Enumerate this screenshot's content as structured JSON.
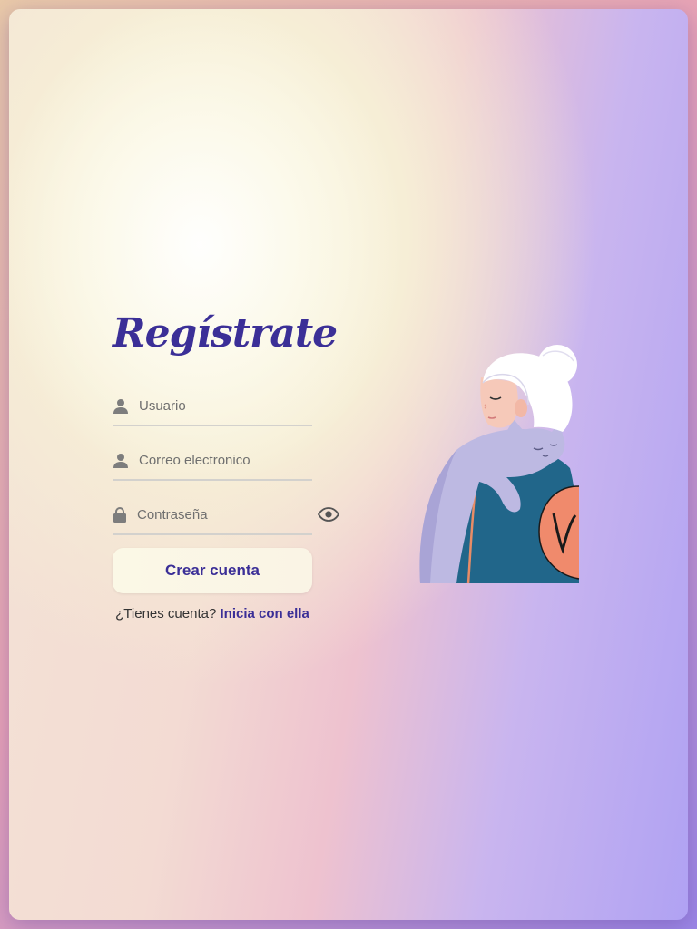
{
  "form": {
    "title": "Regístrate",
    "username_placeholder": "Usuario",
    "email_placeholder": "Correo electronico",
    "password_placeholder": "Contraseña",
    "submit_label": "Crear cuenta",
    "login_prompt": "¿Tienes cuenta?",
    "login_link": "Inicia con ella"
  },
  "icons": {
    "user": "user-icon",
    "email": "user-icon",
    "password": "lock-icon",
    "toggle": "eye-icon"
  },
  "colors": {
    "accent": "#3b2f97",
    "button_bg": "#fbf8e6",
    "illustration_coat": "#21668a",
    "illustration_cat": "#bdb9e2",
    "illustration_badge": "#f08a6c"
  }
}
